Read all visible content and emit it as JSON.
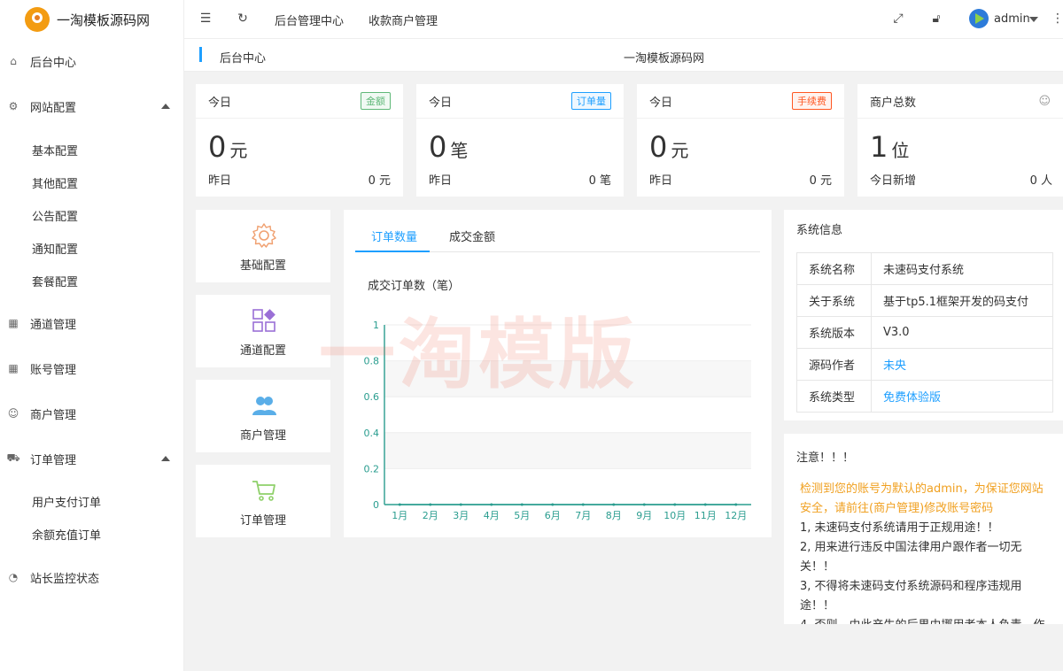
{
  "app": {
    "logo_text": "一淘模板源码网"
  },
  "sidebar": {
    "items": [
      {
        "label": "后台中心",
        "icon": "home-icon"
      },
      {
        "label": "网站配置",
        "icon": "gear-icon",
        "expanded": true,
        "children": [
          "基本配置",
          "其他配置",
          "公告配置",
          "通知配置",
          "套餐配置"
        ]
      },
      {
        "label": "通道管理",
        "icon": "grid-icon"
      },
      {
        "label": "账号管理",
        "icon": "grid-icon"
      },
      {
        "label": "商户管理",
        "icon": "user-icon"
      },
      {
        "label": "订单管理",
        "icon": "cart-icon",
        "expanded": true,
        "children": [
          "用户支付订单",
          "余额充值订单"
        ]
      },
      {
        "label": "站长监控状态",
        "icon": "gauge-icon"
      }
    ]
  },
  "topbar": {
    "links": [
      "后台管理中心",
      "收款商户管理"
    ],
    "user": "admin"
  },
  "breadcrumb": {
    "current": "后台中心",
    "center_title": "一淘模板源码网"
  },
  "stats": [
    {
      "title": "今日",
      "tag": "金额",
      "tag_color": "#5fb878",
      "value": "0",
      "unit": "元",
      "foot_label": "昨日",
      "foot_value": "0 元"
    },
    {
      "title": "今日",
      "tag": "订单量",
      "tag_color": "#1e9fff",
      "value": "0",
      "unit": "笔",
      "foot_label": "昨日",
      "foot_value": "0 笔"
    },
    {
      "title": "今日",
      "tag": "手续费",
      "tag_color": "#ff5722",
      "value": "0",
      "unit": "元",
      "foot_label": "昨日",
      "foot_value": "0 元"
    },
    {
      "title": "商户总数",
      "tag": "",
      "tag_color": "",
      "value": "1",
      "unit": "位",
      "foot_label": "今日新增",
      "foot_value": "0 人"
    }
  ],
  "quick": [
    {
      "label": "基础配置",
      "icon": "gear-icon",
      "color": "#f0a070"
    },
    {
      "label": "通道配置",
      "icon": "apps-icon",
      "color": "#9a6fd6"
    },
    {
      "label": "商户管理",
      "icon": "users-icon",
      "color": "#5aaee8"
    },
    {
      "label": "订单管理",
      "icon": "cart-icon",
      "color": "#8fd06a"
    }
  ],
  "chart_tabs": [
    "订单数量",
    "成交金额"
  ],
  "chart_data": {
    "type": "line",
    "title": "成交订单数（笔）",
    "categories": [
      "1月",
      "2月",
      "3月",
      "4月",
      "5月",
      "6月",
      "7月",
      "8月",
      "9月",
      "10月",
      "11月",
      "12月"
    ],
    "series": [
      {
        "values": [
          0,
          0,
          0,
          0,
          0,
          0,
          0,
          0,
          0,
          0,
          0,
          0
        ]
      }
    ],
    "ylim": [
      0,
      1
    ],
    "yticks": [
      "0",
      "0.2",
      "0.4",
      "0.6",
      "0.8",
      "1"
    ],
    "axis_color": "#2a9d8f"
  },
  "system_info": {
    "title": "系统信息",
    "rows": [
      {
        "k": "系统名称",
        "v": "未速码支付系统",
        "link": false
      },
      {
        "k": "关于系统",
        "v": "基于tp5.1框架开发的码支付",
        "link": false
      },
      {
        "k": "系统版本",
        "v": "V3.0",
        "link": false
      },
      {
        "k": "源码作者",
        "v": "未央",
        "link": true
      },
      {
        "k": "系统类型",
        "v": "免费体验版",
        "link": true
      }
    ]
  },
  "notice": {
    "title": "注意！！！",
    "warning": "检测到您的账号为默认的admin，为保证您网站安全，请前往(商户管理)修改账号密码",
    "lines": [
      "1, 未速码支付系统请用于正规用途！！",
      "2, 用来进行违反中国法律用户跟作者一切无关！！",
      "3, 不得将未速码支付系统源码和程序违规用途！！",
      "4, 否则，由此产生的后果由挪用者本人负责，作"
    ]
  },
  "watermark": "一淘模版"
}
